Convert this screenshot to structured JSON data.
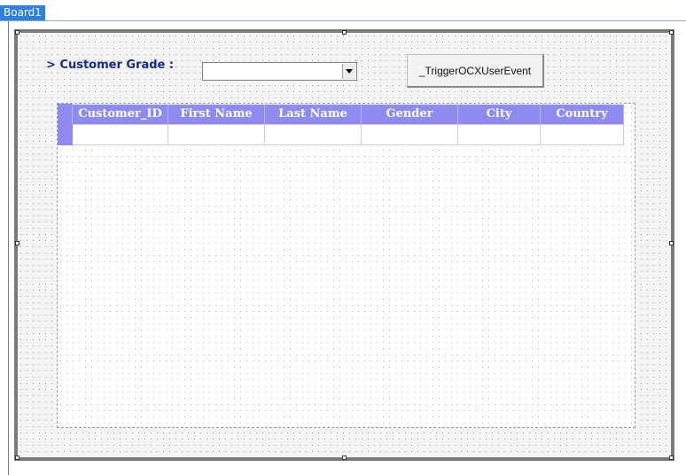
{
  "tab": {
    "label": "Board1"
  },
  "form": {
    "grade_label": "> Customer Grade :",
    "grade_select": {
      "value": ""
    },
    "trigger_button": "_TriggerOCXUserEvent"
  },
  "grid": {
    "columns": [
      "Customer_ID",
      "First Name",
      "Last Name",
      "Gender",
      "City",
      "Country"
    ],
    "rows": [
      [
        "",
        "",
        "",
        "",
        "",
        ""
      ]
    ]
  },
  "colors": {
    "tab": "#2f7fdc",
    "header": "#8d8bf0",
    "label": "#152a8a",
    "board_border": "#7a7a7a"
  }
}
